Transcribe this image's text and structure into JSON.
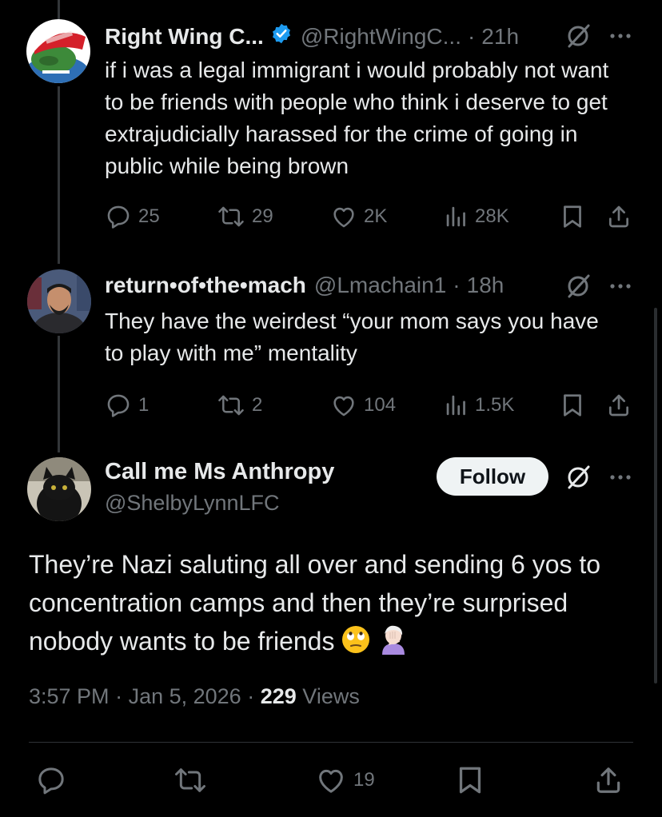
{
  "thread": {
    "replies": [
      {
        "display_name": "Right Wing C...",
        "handle": "@RightWingC...",
        "time": "21h",
        "verified": true,
        "text": "if i was a legal immigrant i would probably not want to be friends with people who think i deserve to get extrajudicially harassed for the crime of going in public while being brown",
        "stats": {
          "replies": "25",
          "reposts": "29",
          "likes": "2K",
          "views": "28K"
        }
      },
      {
        "display_name": "return•of•the•mach",
        "handle": "@Lmachain1",
        "time": "18h",
        "verified": false,
        "text": "They have the weirdest “your mom says you have to play with me” mentality",
        "stats": {
          "replies": "1",
          "reposts": "2",
          "likes": "104",
          "views": "1.5K"
        }
      }
    ]
  },
  "main_post": {
    "display_name": "Call me Ms Anthropy",
    "handle": "@ShelbyLynnLFC",
    "follow_label": "Follow",
    "text": "They’re Nazi saluting all over and sending 6 yos to concentration camps and then they’re surprised nobody wants to be friends",
    "time": "3:57 PM",
    "date": "Jan 5, 2026",
    "views_count": "229",
    "views_label": "Views",
    "likes": "19"
  },
  "colors": {
    "background": "#000000",
    "text": "#e7e9ea",
    "muted": "#71767b",
    "verified_blue": "#1d9bf0",
    "follow_bg": "#eff3f4"
  },
  "icons": [
    "grok-icon",
    "more-icon",
    "reply-icon",
    "repost-icon",
    "like-icon",
    "views-icon",
    "bookmark-icon",
    "share-icon",
    "verified-icon",
    "eye-roll-emoji",
    "facepalm-emoji"
  ]
}
